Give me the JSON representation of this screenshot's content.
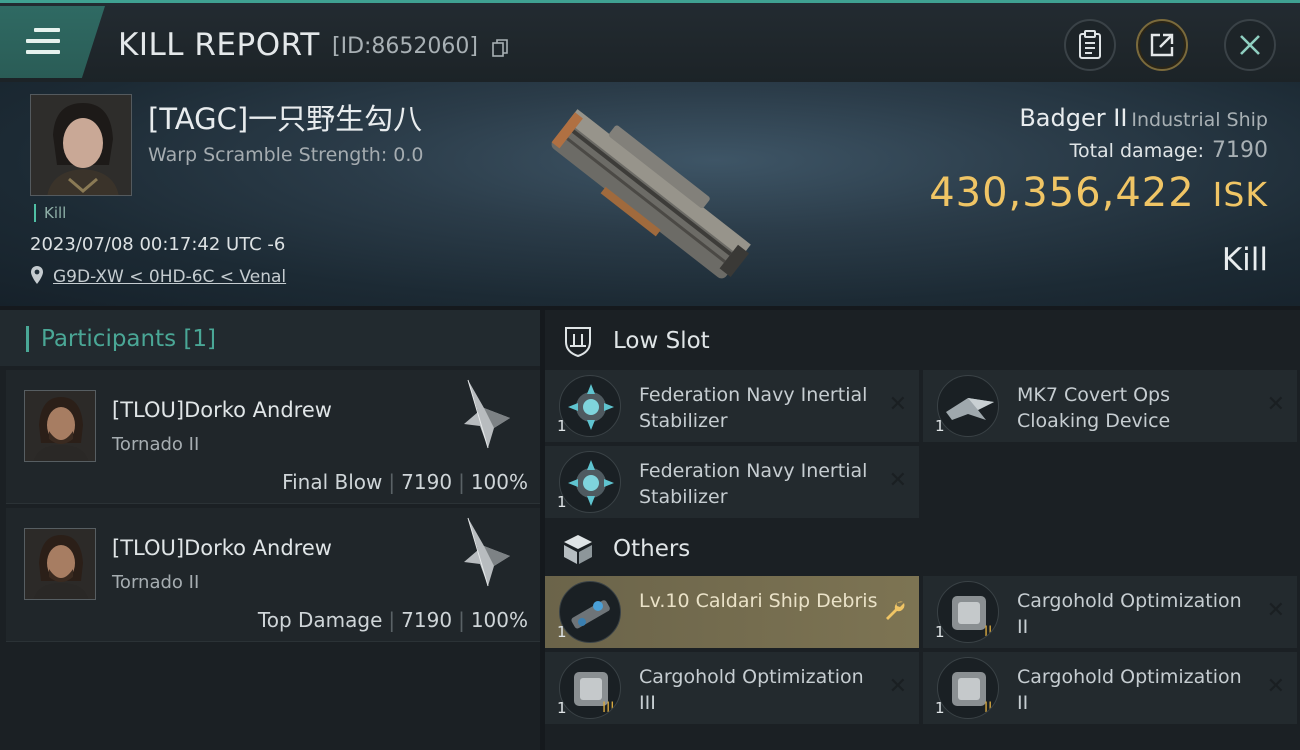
{
  "header": {
    "title": "KILL REPORT",
    "report_id": "[ID:8652060]",
    "icons": {
      "menu": "hamburger-icon",
      "copy": "copy-icon",
      "clipboard": "clipboard-icon",
      "share": "share-icon",
      "close": "close-icon"
    }
  },
  "victim": {
    "name": "[TAGC]一只野生勾八",
    "warp_scramble": "Warp Scramble Strength: 0.0",
    "tag": "Kill",
    "datetime": "2023/07/08 00:17:42 UTC -6",
    "location": "G9D-XW < 0HD-6C < Venal",
    "ship_name": "Badger II",
    "ship_class": "Industrial Ship",
    "damage_label": "Total damage:",
    "damage_value": "7190",
    "isk_value": "430,356,422",
    "isk_unit": "ISK",
    "result": "Kill"
  },
  "participants": {
    "header": "Participants [1]",
    "items": [
      {
        "name": "[TLOU]Dorko Andrew",
        "ship": "Tornado II",
        "role": "Final Blow",
        "damage": "7190",
        "percent": "100%"
      },
      {
        "name": "[TLOU]Dorko Andrew",
        "ship": "Tornado II",
        "role": "Top Damage",
        "damage": "7190",
        "percent": "100%"
      }
    ]
  },
  "fitting": {
    "low_slot": {
      "title": "Low Slot",
      "items": [
        {
          "name": "Federation Navy Inertial Stabilizer",
          "qty": "1",
          "status": "destroyed"
        },
        {
          "name": "MK7 Covert Ops Cloaking Device",
          "qty": "1",
          "status": "destroyed"
        },
        {
          "name": "Federation Navy Inertial Stabilizer",
          "qty": "1",
          "status": "destroyed"
        }
      ]
    },
    "others": {
      "title": "Others",
      "items": [
        {
          "name": "Lv.10 Caldari Ship Debris",
          "qty": "1",
          "status": "dropped"
        },
        {
          "name": "Cargohold Optimization II",
          "qty": "1",
          "status": "destroyed"
        },
        {
          "name": "Cargohold Optimization III",
          "qty": "1",
          "status": "destroyed"
        },
        {
          "name": "Cargohold Optimization II",
          "qty": "1",
          "status": "destroyed"
        }
      ]
    },
    "close_mark": "✕"
  },
  "colors": {
    "accent": "#3fa191",
    "isk": "#f0c565",
    "highlight": "#7d7453"
  }
}
